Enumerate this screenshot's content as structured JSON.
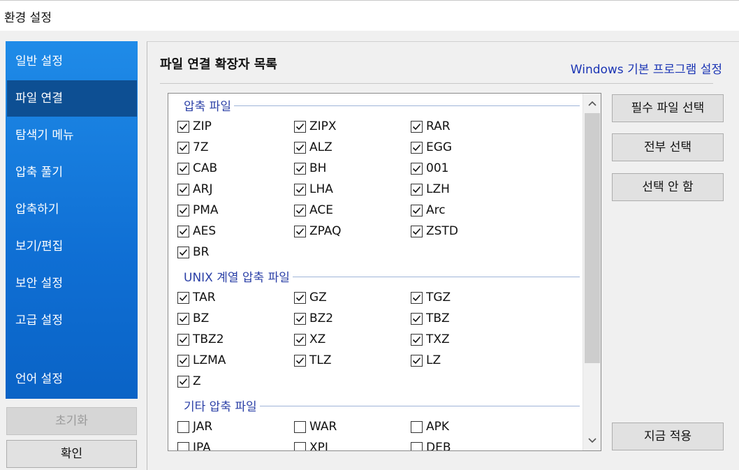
{
  "window": {
    "title": "환경 설정"
  },
  "sidebar": {
    "items": [
      {
        "label": "일반 설정"
      },
      {
        "label": "파일 연결",
        "selected": true
      },
      {
        "label": "탐색기 메뉴"
      },
      {
        "label": "압축 풀기"
      },
      {
        "label": "압축하기"
      },
      {
        "label": "보기/편집"
      },
      {
        "label": "보안 설정"
      },
      {
        "label": "고급 설정"
      },
      {
        "label": "언어 설정"
      }
    ],
    "reset_label": "초기화",
    "ok_label": "확인"
  },
  "main": {
    "title": "파일 연결 확장자 목록",
    "windows_link": "Windows 기본 프로그램 설정",
    "groups": [
      {
        "header": "압축 파일",
        "items": [
          {
            "label": "ZIP",
            "checked": true
          },
          {
            "label": "ZIPX",
            "checked": true
          },
          {
            "label": "RAR",
            "checked": true
          },
          {
            "label": "7Z",
            "checked": true
          },
          {
            "label": "ALZ",
            "checked": true
          },
          {
            "label": "EGG",
            "checked": true
          },
          {
            "label": "CAB",
            "checked": true
          },
          {
            "label": "BH",
            "checked": true
          },
          {
            "label": "001",
            "checked": true
          },
          {
            "label": "ARJ",
            "checked": true
          },
          {
            "label": "LHA",
            "checked": true
          },
          {
            "label": "LZH",
            "checked": true
          },
          {
            "label": "PMA",
            "checked": true
          },
          {
            "label": "ACE",
            "checked": true
          },
          {
            "label": "Arc",
            "checked": true
          },
          {
            "label": "AES",
            "checked": true
          },
          {
            "label": "ZPAQ",
            "checked": true
          },
          {
            "label": "ZSTD",
            "checked": true
          },
          {
            "label": "BR",
            "checked": true
          }
        ]
      },
      {
        "header": "UNIX 계열 압축 파일",
        "items": [
          {
            "label": "TAR",
            "checked": true
          },
          {
            "label": "GZ",
            "checked": true
          },
          {
            "label": "TGZ",
            "checked": true
          },
          {
            "label": "BZ",
            "checked": true
          },
          {
            "label": "BZ2",
            "checked": true
          },
          {
            "label": "TBZ",
            "checked": true
          },
          {
            "label": "TBZ2",
            "checked": true
          },
          {
            "label": "XZ",
            "checked": true
          },
          {
            "label": "TXZ",
            "checked": true
          },
          {
            "label": "LZMA",
            "checked": true
          },
          {
            "label": "TLZ",
            "checked": true
          },
          {
            "label": "LZ",
            "checked": true
          },
          {
            "label": "Z",
            "checked": true
          }
        ]
      },
      {
        "header": "기타 압축 파일",
        "items": [
          {
            "label": "JAR",
            "checked": false
          },
          {
            "label": "WAR",
            "checked": false
          },
          {
            "label": "APK",
            "checked": false
          },
          {
            "label": "IPA",
            "checked": false
          },
          {
            "label": "XPI",
            "checked": false
          },
          {
            "label": "DEB",
            "checked": false
          }
        ]
      }
    ]
  },
  "actions": {
    "select_required": "필수 파일 선택",
    "select_all": "전부 선택",
    "select_none": "선택 안 함",
    "apply_now": "지금 적용"
  },
  "icons": {
    "scroll_up": "chevron-up-icon",
    "scroll_down": "chevron-down-icon",
    "check": "checkmark-icon"
  },
  "colors": {
    "sidebar": "#0f6fd4",
    "sidebar_selected": "#0d4f93",
    "link": "#1a34b4",
    "group_header": "#2a3fa6"
  }
}
